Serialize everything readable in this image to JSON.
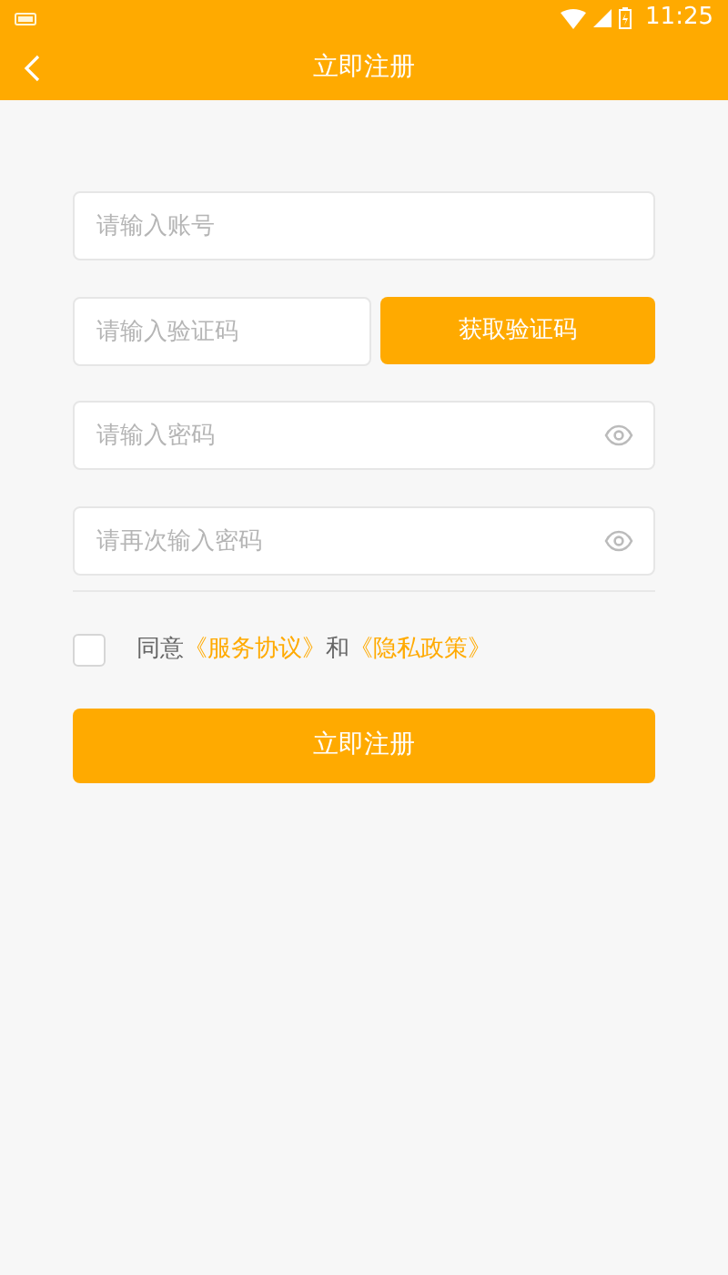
{
  "status_bar": {
    "time": "11:25"
  },
  "header": {
    "title": "立即注册"
  },
  "fields": [
    {
      "kind": "text",
      "placeholder": "请输入账号"
    },
    {
      "kind": "code",
      "placeholder": "请输入验证码",
      "button": "获取验证码"
    },
    {
      "kind": "password",
      "placeholder": "请输入密码"
    },
    {
      "kind": "password",
      "placeholder": "请再次输入密码"
    }
  ],
  "agreement": {
    "checked": false,
    "parts": [
      {
        "kind": "text",
        "text": "同意"
      },
      {
        "kind": "link",
        "text": "《服务协议》"
      },
      {
        "kind": "text",
        "text": "和"
      },
      {
        "kind": "link",
        "text": "《隐私政策》"
      }
    ]
  },
  "submit_button": "立即注册"
}
